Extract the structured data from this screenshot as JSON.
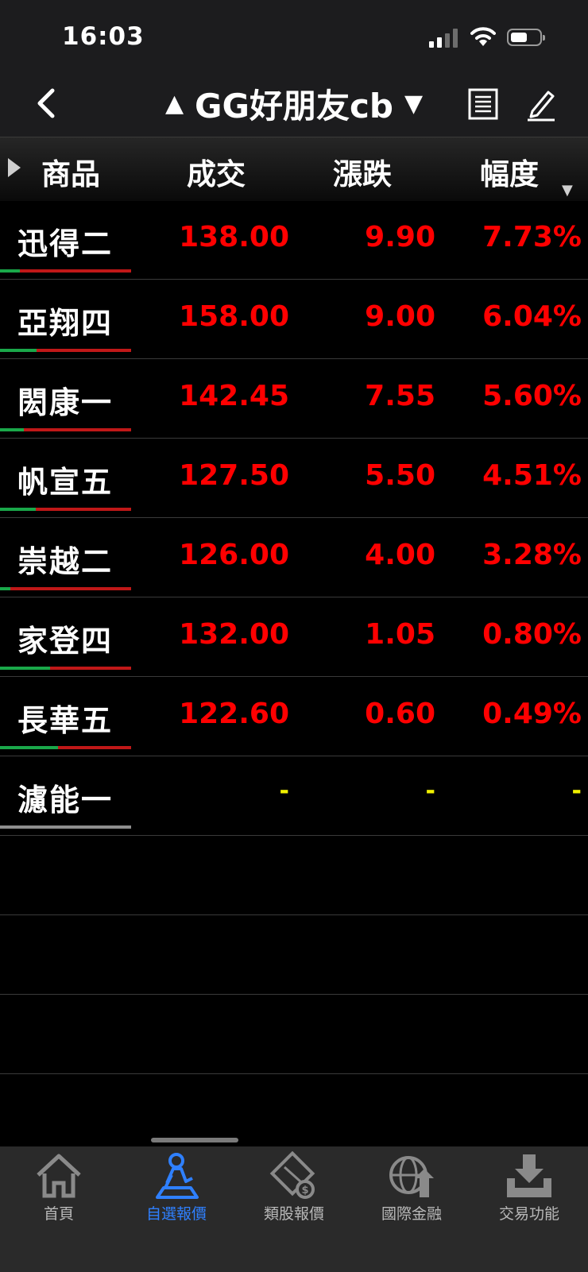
{
  "status_bar": {
    "time": "16:03"
  },
  "header": {
    "title": "GG好朋友cb",
    "prev_symbol": "▲",
    "next_symbol": "▼"
  },
  "columns": {
    "name": "商品",
    "price": "成交",
    "change": "漲跌",
    "percent": "幅度"
  },
  "rows": [
    {
      "name": "迅得二",
      "price": "138.00",
      "change": "9.90",
      "percent": "7.73%",
      "up_ratio": 0.15
    },
    {
      "name": "亞翔四",
      "price": "158.00",
      "change": "9.00",
      "percent": "6.04%",
      "up_ratio": 0.28
    },
    {
      "name": "閎康一",
      "price": "142.45",
      "change": "7.55",
      "percent": "5.60%",
      "up_ratio": 0.18
    },
    {
      "name": "帆宣五",
      "price": "127.50",
      "change": "5.50",
      "percent": "4.51%",
      "up_ratio": 0.27
    },
    {
      "name": "崇越二",
      "price": "126.00",
      "change": "4.00",
      "percent": "3.28%",
      "up_ratio": 0.08
    },
    {
      "name": "家登四",
      "price": "132.00",
      "change": "1.05",
      "percent": "0.80%",
      "up_ratio": 0.38
    },
    {
      "name": "長華五",
      "price": "122.60",
      "change": "0.60",
      "percent": "0.49%",
      "up_ratio": 0.44
    },
    {
      "name": "濾能一",
      "price": "-",
      "change": "-",
      "percent": "-",
      "up_ratio": null
    }
  ],
  "tabs": [
    {
      "label": "首頁",
      "icon": "home-icon",
      "active": false
    },
    {
      "label": "自選報價",
      "icon": "person-desk-icon",
      "active": true
    },
    {
      "label": "類股報價",
      "icon": "film-coin-icon",
      "active": false
    },
    {
      "label": "國際金融",
      "icon": "globe-arrow-icon",
      "active": false
    },
    {
      "label": "交易功能",
      "icon": "download-tray-icon",
      "active": false
    }
  ],
  "colors": {
    "up": "#ff0000",
    "neutral": "#f0f000",
    "accent": "#2f80ff"
  }
}
